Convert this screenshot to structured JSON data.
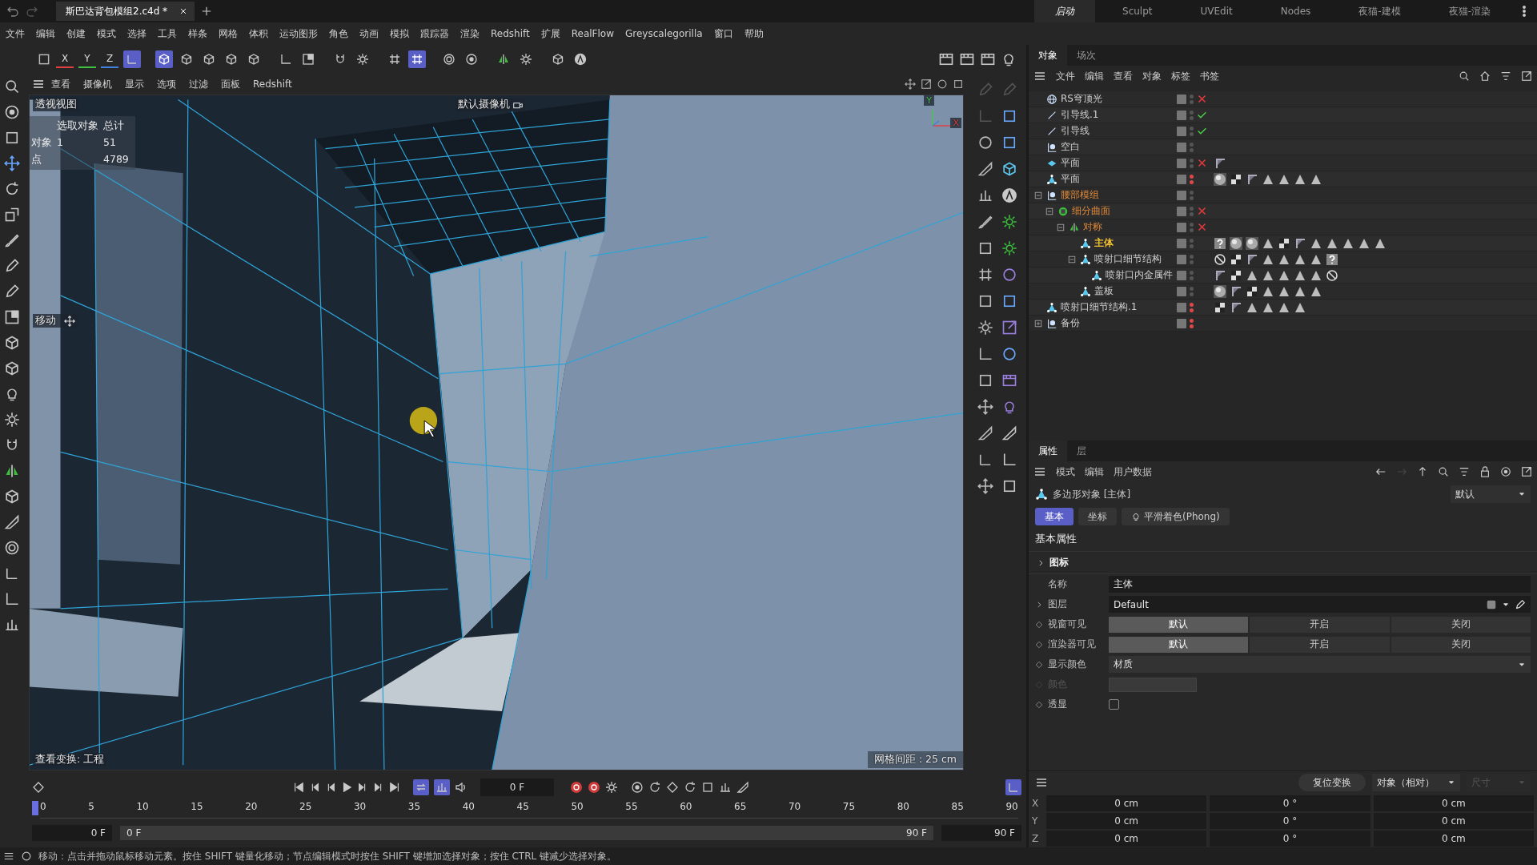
{
  "title_bar": {
    "tabs": [
      {
        "label": "斯巴达背包模组2.c4d *",
        "selected": true
      }
    ],
    "layouts": [
      {
        "label": "启动",
        "selected": true
      },
      {
        "label": "Sculpt",
        "selected": false
      },
      {
        "label": "UVEdit",
        "selected": false
      },
      {
        "label": "Nodes",
        "selected": false
      },
      {
        "label": "夜猫-建模",
        "selected": false
      },
      {
        "label": "夜猫-渲染",
        "selected": false
      }
    ]
  },
  "menu_bar": [
    "文件",
    "编辑",
    "创建",
    "模式",
    "选择",
    "工具",
    "样条",
    "网格",
    "体积",
    "运动图形",
    "角色",
    "动画",
    "模拟",
    "跟踪器",
    "渲染",
    "Redshift",
    "扩展",
    "RealFlow",
    "Greyscalegorilla",
    "窗口",
    "帮助"
  ],
  "axis_buttons": [
    "X",
    "Y",
    "Z"
  ],
  "viewport": {
    "menu": [
      "查看",
      "摄像机",
      "显示",
      "选项",
      "过滤",
      "面板",
      "Redshift"
    ],
    "view_name": "透视视图",
    "camera": "默认摄像机",
    "stats": {
      "header": [
        "选取对象",
        "总计"
      ],
      "rows": [
        {
          "label": "对象",
          "selection": "1",
          "total": "51"
        },
        {
          "label": "点",
          "total": "4789"
        }
      ]
    },
    "tool_label": "移动",
    "view_transform": "查看变换: 工程",
    "grid_spacing": "网格间距 : 25 cm",
    "axis_labels": [
      "Y",
      "X"
    ]
  },
  "object_manager": {
    "tabs": [
      {
        "label": "对象",
        "selected": true
      },
      {
        "label": "场次",
        "selected": false
      }
    ],
    "menu": [
      "文件",
      "编辑",
      "查看",
      "对象",
      "标签",
      "书签"
    ],
    "items": [
      {
        "name": "RS穹顶光",
        "kind": "sky",
        "selected": false,
        "on_path": false,
        "editor_off": false,
        "render_off": false,
        "enabled": false
      },
      {
        "name": "引导线.1",
        "kind": "spline",
        "selected": false,
        "on_path": false,
        "editor_off": false,
        "render_off": false,
        "enabled": true
      },
      {
        "name": "引导线",
        "kind": "spline",
        "selected": false,
        "on_path": false,
        "editor_off": false,
        "render_off": false,
        "enabled": true
      },
      {
        "name": "空白",
        "kind": "null",
        "selected": false,
        "on_path": false,
        "editor_off": false,
        "render_off": false
      },
      {
        "name": "平面",
        "kind": "plane",
        "selected": false,
        "on_path": false,
        "editor_off": false,
        "render_off": false,
        "enabled": false,
        "tags": [
          {
            "kind": "flag"
          }
        ]
      },
      {
        "name": "平面",
        "kind": "poly",
        "selected": false,
        "on_path": false,
        "editor_off": true,
        "render_off": true,
        "tags": [
          {
            "kind": "sphere"
          },
          {
            "kind": "checker"
          },
          {
            "kind": "flag"
          },
          {
            "kind": "triangle"
          },
          {
            "kind": "triangle"
          },
          {
            "kind": "triangle"
          },
          {
            "kind": "triangle"
          }
        ]
      },
      {
        "name": "腰部模组",
        "kind": "null",
        "selected": false,
        "on_path": true,
        "editor_off": false,
        "render_off": false,
        "expanded": true,
        "children": [
          {
            "name": "细分曲面",
            "kind": "subdiv",
            "selected": false,
            "on_path": true,
            "editor_off": false,
            "render_off": false,
            "enabled": false,
            "expanded": true,
            "children": [
              {
                "name": "对称",
                "kind": "symmetry",
                "selected": false,
                "on_path": true,
                "editor_off": false,
                "render_off": false,
                "enabled": false,
                "expanded": true,
                "children": [
                  {
                    "name": "主体",
                    "kind": "poly",
                    "selected": true,
                    "on_path": false,
                    "editor_off": false,
                    "render_off": false,
                    "tags": [
                      {
                        "kind": "question"
                      },
                      {
                        "kind": "sphere"
                      },
                      {
                        "kind": "sphere"
                      },
                      {
                        "kind": "triangle"
                      },
                      {
                        "kind": "checker"
                      },
                      {
                        "kind": "flag"
                      },
                      {
                        "kind": "triangle"
                      },
                      {
                        "kind": "triangle"
                      },
                      {
                        "kind": "triangle"
                      },
                      {
                        "kind": "triangle"
                      },
                      {
                        "kind": "triangle"
                      }
                    ]
                  },
                  {
                    "name": "喷射口细节结构",
                    "kind": "poly",
                    "selected": false,
                    "on_path": false,
                    "editor_off": false,
                    "render_off": false,
                    "expanded": true,
                    "tags": [
                      {
                        "kind": "forbid"
                      },
                      {
                        "kind": "checker"
                      },
                      {
                        "kind": "flag"
                      },
                      {
                        "kind": "triangle"
                      },
                      {
                        "kind": "triangle"
                      },
                      {
                        "kind": "triangle"
                      },
                      {
                        "kind": "triangle"
                      },
                      {
                        "kind": "question"
                      }
                    ],
                    "children": [
                      {
                        "name": "喷射口内金属件",
                        "kind": "poly",
                        "selected": false,
                        "on_path": false,
                        "editor_off": false,
                        "render_off": false,
                        "tags": [
                          {
                            "kind": "flag"
                          },
                          {
                            "kind": "checker"
                          },
                          {
                            "kind": "triangle"
                          },
                          {
                            "kind": "triangle"
                          },
                          {
                            "kind": "triangle"
                          },
                          {
                            "kind": "triangle"
                          },
                          {
                            "kind": "triangle"
                          },
                          {
                            "kind": "forbid"
                          }
                        ]
                      }
                    ]
                  },
                  {
                    "name": "盖板",
                    "kind": "poly",
                    "selected": false,
                    "on_path": false,
                    "editor_off": false,
                    "render_off": false,
                    "tags": [
                      {
                        "kind": "sphere"
                      },
                      {
                        "kind": "flag"
                      },
                      {
                        "kind": "checker"
                      },
                      {
                        "kind": "triangle"
                      },
                      {
                        "kind": "triangle"
                      },
                      {
                        "kind": "triangle"
                      },
                      {
                        "kind": "triangle"
                      }
                    ]
                  }
                ]
              }
            ]
          }
        ]
      },
      {
        "name": "喷射口细节结构.1",
        "kind": "poly",
        "selected": false,
        "on_path": false,
        "editor_off": true,
        "render_off": true,
        "tags": [
          {
            "kind": "checker"
          },
          {
            "kind": "flag"
          },
          {
            "kind": "triangle"
          },
          {
            "kind": "triangle"
          },
          {
            "kind": "triangle"
          },
          {
            "kind": "triangle"
          }
        ]
      },
      {
        "name": "备份",
        "kind": "null",
        "selected": false,
        "on_path": false,
        "editor_off": true,
        "render_off": true,
        "expanded": false
      }
    ]
  },
  "attributes": {
    "tabs": [
      {
        "label": "属性",
        "selected": true
      },
      {
        "label": "层",
        "selected": false
      }
    ],
    "menu": [
      "模式",
      "编辑",
      "用户数据"
    ],
    "object_title": "多边形对象 [主体]",
    "preset": "默认",
    "sub_tabs": [
      {
        "label": "基本",
        "selected": true
      },
      {
        "label": "坐标",
        "selected": false
      },
      {
        "label": "平滑着色(Phong)",
        "selected": false
      }
    ],
    "section": "基本属性",
    "group": {
      "label": "图标",
      "expanded": false
    },
    "fields": [
      {
        "kind": "text",
        "label": "名称",
        "value": "主体",
        "disabled": false
      },
      {
        "kind": "layer",
        "label": "图层",
        "value": "Default",
        "disabled": false
      },
      {
        "kind": "segmented",
        "label": "视窗可见",
        "disabled": false,
        "options": [
          {
            "label": "默认",
            "selected": true
          },
          {
            "label": "开启",
            "selected": false
          },
          {
            "label": "关闭",
            "selected": false
          }
        ]
      },
      {
        "kind": "segmented",
        "label": "渲染器可见",
        "disabled": false,
        "options": [
          {
            "label": "默认",
            "selected": true
          },
          {
            "label": "开启",
            "selected": false
          },
          {
            "label": "关闭",
            "selected": false
          }
        ]
      },
      {
        "kind": "dropdown",
        "label": "显示颜色",
        "value": "材质",
        "disabled": false
      },
      {
        "kind": "color",
        "label": "颜色",
        "disabled": true
      },
      {
        "kind": "checkbox",
        "label": "透显",
        "checked": false,
        "disabled": false
      }
    ]
  },
  "coordinates": {
    "reset_button": "复位变换",
    "mode": "对象（相对）",
    "size": {
      "label": "尺寸",
      "disabled": true
    },
    "rows": [
      {
        "axis": "X",
        "position": "0 cm",
        "rotation": "0 °",
        "scale": "0 cm"
      },
      {
        "axis": "Y",
        "position": "0 cm",
        "rotation": "0 °",
        "scale": "0 cm"
      },
      {
        "axis": "Z",
        "position": "0 cm",
        "rotation": "0 °",
        "scale": "0 cm"
      }
    ]
  },
  "timeline": {
    "current_frame": "0 F",
    "ruler": [
      "0",
      "5",
      "10",
      "15",
      "20",
      "25",
      "30",
      "35",
      "40",
      "45",
      "50",
      "55",
      "60",
      "65",
      "70",
      "75",
      "80",
      "85",
      "90"
    ],
    "level": 0,
    "range": {
      "start": "0 F",
      "slider_start": "0 F",
      "slider_end": "90 F",
      "end": "90 F",
      "level": 1
    }
  },
  "status_bar": "移动：点击并拖动鼠标移动元素。按住 SHIFT 键量化移动；节点编辑模式时按住 SHIFT 键增加选择对象；按住 CTRL 键减少选择对象。"
}
